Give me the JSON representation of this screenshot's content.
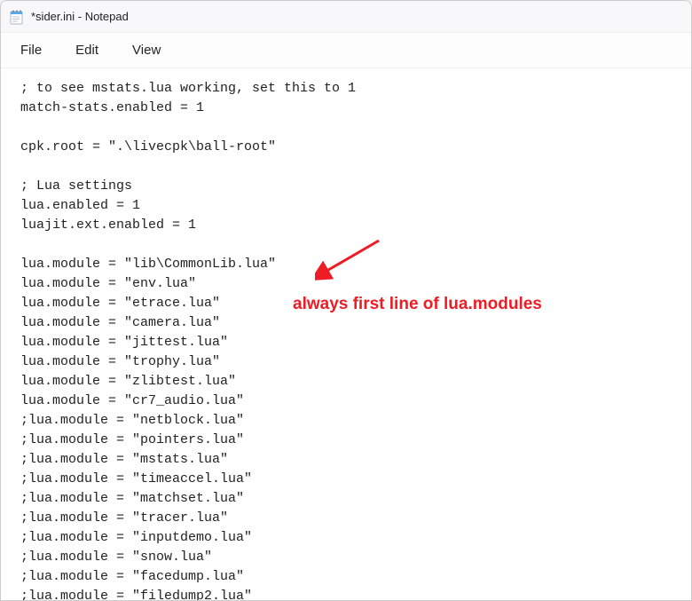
{
  "window": {
    "title": "*sider.ini - Notepad"
  },
  "menu": {
    "file": "File",
    "edit": "Edit",
    "view": "View"
  },
  "content": {
    "lines": [
      "; to see mstats.lua working, set this to 1",
      "match-stats.enabled = 1",
      "",
      "cpk.root = \".\\livecpk\\ball-root\"",
      "",
      "; Lua settings",
      "lua.enabled = 1",
      "luajit.ext.enabled = 1",
      "",
      "lua.module = \"lib\\CommonLib.lua\"",
      "lua.module = \"env.lua\"",
      "lua.module = \"etrace.lua\"",
      "lua.module = \"camera.lua\"",
      "lua.module = \"jittest.lua\"",
      "lua.module = \"trophy.lua\"",
      "lua.module = \"zlibtest.lua\"",
      "lua.module = \"cr7_audio.lua\"",
      ";lua.module = \"netblock.lua\"",
      ";lua.module = \"pointers.lua\"",
      ";lua.module = \"mstats.lua\"",
      ";lua.module = \"timeaccel.lua\"",
      ";lua.module = \"matchset.lua\"",
      ";lua.module = \"tracer.lua\"",
      ";lua.module = \"inputdemo.lua\"",
      ";lua.module = \"snow.lua\"",
      ";lua.module = \"facedump.lua\"",
      ";lua.module = \"filedump2.lua\""
    ]
  },
  "annotation": {
    "text": "always first line of lua.modules",
    "color": "#ee1c25"
  }
}
